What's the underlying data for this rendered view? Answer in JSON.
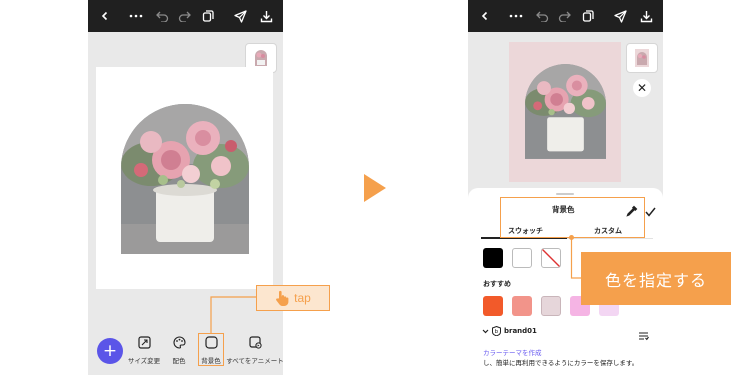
{
  "left_screen": {
    "toolbar": [
      "back-icon",
      "more-icon",
      "undo-icon",
      "redo-icon",
      "layers-icon",
      "share-icon",
      "download-icon"
    ],
    "bottom_tools": [
      {
        "label": "サイズ変更",
        "icon": "resize-icon"
      },
      {
        "label": "配色",
        "icon": "palette-icon"
      },
      {
        "label": "背景色",
        "icon": "background-color-icon"
      },
      {
        "label": "すべてをアニメート",
        "icon": "animate-icon"
      }
    ],
    "add_button": "+",
    "tap_label": "tap"
  },
  "right_screen": {
    "sheet_title": "背景色",
    "tabs": [
      "スウォッチ",
      "カスタム"
    ],
    "recommended_label": "おすすめ",
    "swatches": [
      "#000000",
      "#ffffff",
      "none"
    ],
    "recommended_colors": [
      "#f25a2a",
      "#f2948a",
      "#e6d6da",
      "#f5b4e4",
      "#f3d6f3"
    ],
    "brand_name": "brand01",
    "create_theme_link": "カラーテーマを作成",
    "helper_text": "し、簡単に再利用できるようにカラーを保存します。",
    "canvas_bg": "#ecd7d9"
  },
  "callout": "色を指定する",
  "accent": "#f5a04c"
}
